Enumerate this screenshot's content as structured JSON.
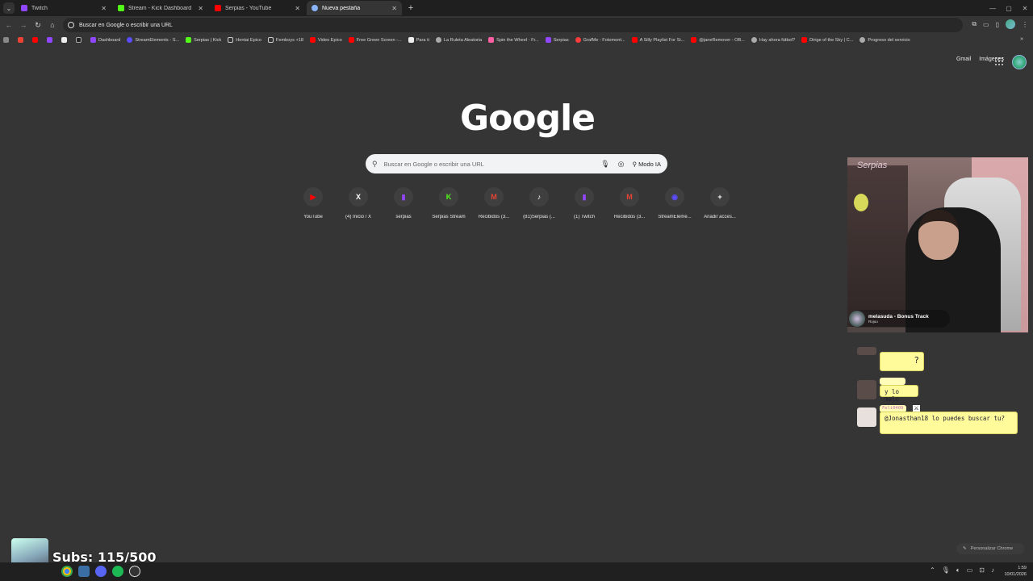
{
  "tabs": [
    {
      "title": "Twitch",
      "color": "#9146ff"
    },
    {
      "title": "Stream - Kick Dashboard",
      "color": "#53fc18"
    },
    {
      "title": "Serpias - YouTube",
      "color": "#ff0000"
    },
    {
      "title": "Nueva pestaña",
      "color": "#8ab4f8"
    }
  ],
  "omnibox": {
    "text": "Buscar en Google o escribir una URL"
  },
  "bookmarks": [
    {
      "label": "Dashboard",
      "color": "#9146ff"
    },
    {
      "label": "StreamElements - S...",
      "color": "#5b4cff"
    },
    {
      "label": "Serpias | Kick",
      "color": "#53fc18"
    },
    {
      "label": "Hentai Epico",
      "color": "#cccccc"
    },
    {
      "label": "Femboys +18",
      "color": "#cccccc"
    },
    {
      "label": "Video Epico",
      "color": "#ff0000"
    },
    {
      "label": "Free Green Screen -...",
      "color": "#ff0000"
    },
    {
      "label": "Para ti",
      "color": "#ffffff"
    },
    {
      "label": "La Ruleta Aleatoria",
      "color": "#cccccc"
    },
    {
      "label": "Spin the Wheel - Fr...",
      "color": "#ff5fa2"
    },
    {
      "label": "Serpias",
      "color": "#9146ff"
    },
    {
      "label": "GrafMe - Fotomont...",
      "color": "#ff3b3b"
    },
    {
      "label": "A Silly Playlist For Si...",
      "color": "#ff0000"
    },
    {
      "label": "@janeRemover - OB...",
      "color": "#ff0000"
    },
    {
      "label": "Hay ahora fútbol?",
      "color": "#cccccc"
    },
    {
      "label": "Dirige of the Sky | C...",
      "color": "#ff0000"
    },
    {
      "label": "Progreso del servicio",
      "color": "#cccccc"
    }
  ],
  "ntp": {
    "gmail": "Gmail",
    "images": "Imágenes",
    "logo": "Google",
    "search_placeholder": "Buscar en Google o escribir una URL",
    "ai_mode": "Modo IA",
    "customize": "Personalizar Chrome"
  },
  "shortcuts": [
    {
      "label": "YouTube",
      "glyph": "▶",
      "color": "#ff0000"
    },
    {
      "label": "(4) Inicio / X",
      "glyph": "X",
      "color": "#ffffff"
    },
    {
      "label": "serpias",
      "glyph": "▮",
      "color": "#9146ff"
    },
    {
      "label": "Serpias Stream",
      "glyph": "K",
      "color": "#53fc18"
    },
    {
      "label": "Recibidos (3...",
      "glyph": "M",
      "color": "#ea4335"
    },
    {
      "label": "(81)Serpias (...",
      "glyph": "♪",
      "color": "#ffffff"
    },
    {
      "label": "(1) Twitch",
      "glyph": "▮",
      "color": "#9146ff"
    },
    {
      "label": "Recibidos (3...",
      "glyph": "M",
      "color": "#ea4335"
    },
    {
      "label": "StreamEleme...",
      "glyph": "◉",
      "color": "#5b4cff"
    },
    {
      "label": "Añadir acces...",
      "glyph": "+",
      "color": "#ffffff"
    }
  ],
  "webcam": {
    "brand": "Serpias",
    "now_playing": {
      "song": "melasuda - Bonus Track",
      "artist": "Rojuu"
    }
  },
  "chat": [
    {
      "name": "",
      "message": "?"
    },
    {
      "name": "",
      "message": "y lo malo"
    },
    {
      "name": "Feli0409",
      "message": "@Jonasthan18 lo puedes buscar tu?"
    }
  ],
  "subs": {
    "text": "Subs: 115/500"
  },
  "clock": {
    "time": "1:59",
    "date": "10/01/2026"
  }
}
